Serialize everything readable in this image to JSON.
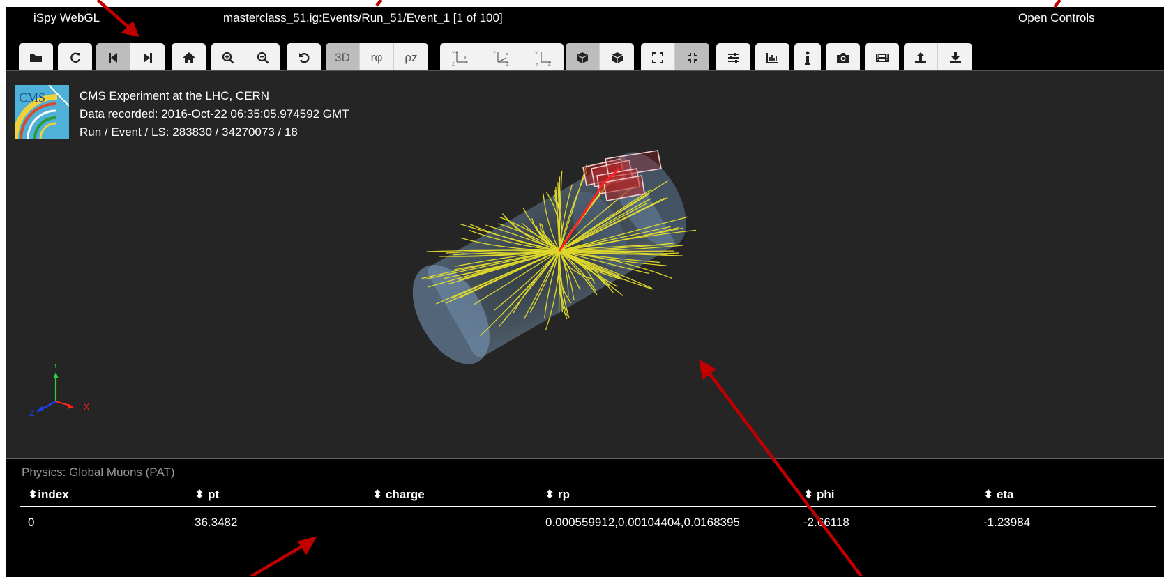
{
  "titlebar": {
    "app_name": "iSpy WebGL",
    "file_path": "masterclass_51.ig:Events/Run_51/Event_1 [1 of 100]",
    "open_controls": "Open Controls"
  },
  "toolbar": {
    "view_3d": "3D",
    "view_rphi": "rφ",
    "view_rz": "ρz"
  },
  "event_info": {
    "line1": "CMS Experiment at the LHC, CERN",
    "line2": "Data recorded: 2016-Oct-22 06:35:05.974592 GMT",
    "line3": "Run / Event / LS: 283830 / 34270073 / 18"
  },
  "logo": {
    "text": "CMS"
  },
  "axes": {
    "x": "X",
    "y": "Y",
    "z": "Z"
  },
  "table": {
    "title": "Physics: Global Muons (PAT)",
    "headers": [
      "⬍index",
      "⬍ pt",
      "⬍ charge",
      "⬍ rp",
      "⬍ phi",
      "⬍ eta"
    ],
    "rows": [
      {
        "index": "0",
        "pt": "36.3482",
        "charge": "",
        "rp": "0.000559912,0.00104404,0.0168395",
        "phi": "-2.66118",
        "eta": "-1.23984"
      }
    ]
  },
  "colors": {
    "background": "#000000",
    "viewport": "#252525",
    "tracks": "#e8e02a",
    "muon": "#ff2020",
    "annotation_arrow": "#c00000"
  }
}
